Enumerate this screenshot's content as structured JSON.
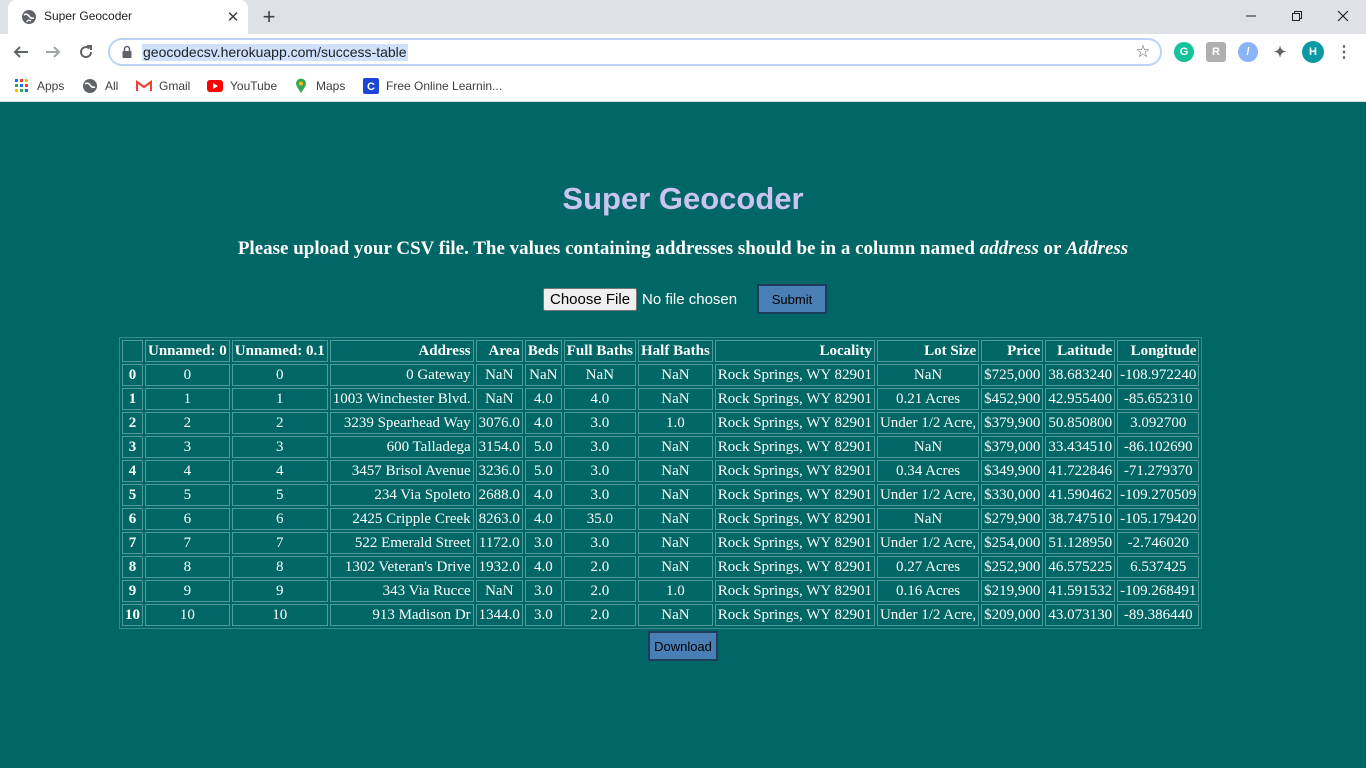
{
  "browser": {
    "tab_title": "Super Geocoder",
    "url": "geocodecsv.herokuapp.com/success-table",
    "extension_avatar_letter": "H",
    "bookmarks": [
      {
        "label": "Apps",
        "icon": "apps-grid-icon"
      },
      {
        "label": "All",
        "icon": "globe-icon"
      },
      {
        "label": "Gmail",
        "icon": "gmail-icon"
      },
      {
        "label": "YouTube",
        "icon": "youtube-icon"
      },
      {
        "label": "Maps",
        "icon": "maps-pin-icon"
      },
      {
        "label": "Free Online Learnin...",
        "icon": "learning-icon"
      }
    ]
  },
  "page": {
    "title": "Super Geocoder",
    "instruction_prefix": "Please upload your CSV file. The values containing addresses should be in a column named ",
    "instruction_term1": "address",
    "instruction_or": " or ",
    "instruction_term2": "Address",
    "choose_file_label": "Choose File",
    "no_file_text": "No file chosen",
    "submit_label": "Submit",
    "download_label": "Download"
  },
  "table": {
    "columns": [
      "",
      "Unnamed: 0",
      "Unnamed: 0.1",
      "Address",
      "Area",
      "Beds",
      "Full Baths",
      "Half Baths",
      "Locality",
      "Lot Size",
      "Price",
      "Latitude",
      "Longitude"
    ],
    "rows": [
      [
        "0",
        "0",
        "0",
        "0 Gateway",
        "NaN",
        "NaN",
        "NaN",
        "NaN",
        "Rock Springs, WY 82901",
        "NaN",
        "$725,000",
        "38.683240",
        "-108.972240"
      ],
      [
        "1",
        "1",
        "1",
        "1003 Winchester Blvd.",
        "NaN",
        "4.0",
        "4.0",
        "NaN",
        "Rock Springs, WY 82901",
        "0.21 Acres",
        "$452,900",
        "42.955400",
        "-85.652310"
      ],
      [
        "2",
        "2",
        "2",
        "3239 Spearhead Way",
        "3076.0",
        "4.0",
        "3.0",
        "1.0",
        "Rock Springs, WY 82901",
        "Under 1/2 Acre,",
        "$379,900",
        "50.850800",
        "3.092700"
      ],
      [
        "3",
        "3",
        "3",
        "600 Talladega",
        "3154.0",
        "5.0",
        "3.0",
        "NaN",
        "Rock Springs, WY 82901",
        "NaN",
        "$379,000",
        "33.434510",
        "-86.102690"
      ],
      [
        "4",
        "4",
        "4",
        "3457 Brisol Avenue",
        "3236.0",
        "5.0",
        "3.0",
        "NaN",
        "Rock Springs, WY 82901",
        "0.34 Acres",
        "$349,900",
        "41.722846",
        "-71.279370"
      ],
      [
        "5",
        "5",
        "5",
        "234 Via Spoleto",
        "2688.0",
        "4.0",
        "3.0",
        "NaN",
        "Rock Springs, WY 82901",
        "Under 1/2 Acre,",
        "$330,000",
        "41.590462",
        "-109.270509"
      ],
      [
        "6",
        "6",
        "6",
        "2425 Cripple Creek",
        "8263.0",
        "4.0",
        "35.0",
        "NaN",
        "Rock Springs, WY 82901",
        "NaN",
        "$279,900",
        "38.747510",
        "-105.179420"
      ],
      [
        "7",
        "7",
        "7",
        "522 Emerald Street",
        "1172.0",
        "3.0",
        "3.0",
        "NaN",
        "Rock Springs, WY 82901",
        "Under 1/2 Acre,",
        "$254,000",
        "51.128950",
        "-2.746020"
      ],
      [
        "8",
        "8",
        "8",
        "1302 Veteran's Drive",
        "1932.0",
        "4.0",
        "2.0",
        "NaN",
        "Rock Springs, WY 82901",
        "0.27 Acres",
        "$252,900",
        "46.575225",
        "6.537425"
      ],
      [
        "9",
        "9",
        "9",
        "343 Via Rucce",
        "NaN",
        "3.0",
        "2.0",
        "1.0",
        "Rock Springs, WY 82901",
        "0.16 Acres",
        "$219,900",
        "41.591532",
        "-109.268491"
      ],
      [
        "10",
        "10",
        "10",
        "913 Madison Dr",
        "1344.0",
        "3.0",
        "2.0",
        "NaN",
        "Rock Springs, WY 82901",
        "Under 1/2 Acre,",
        "$209,000",
        "43.073130",
        "-89.386440"
      ]
    ]
  }
}
